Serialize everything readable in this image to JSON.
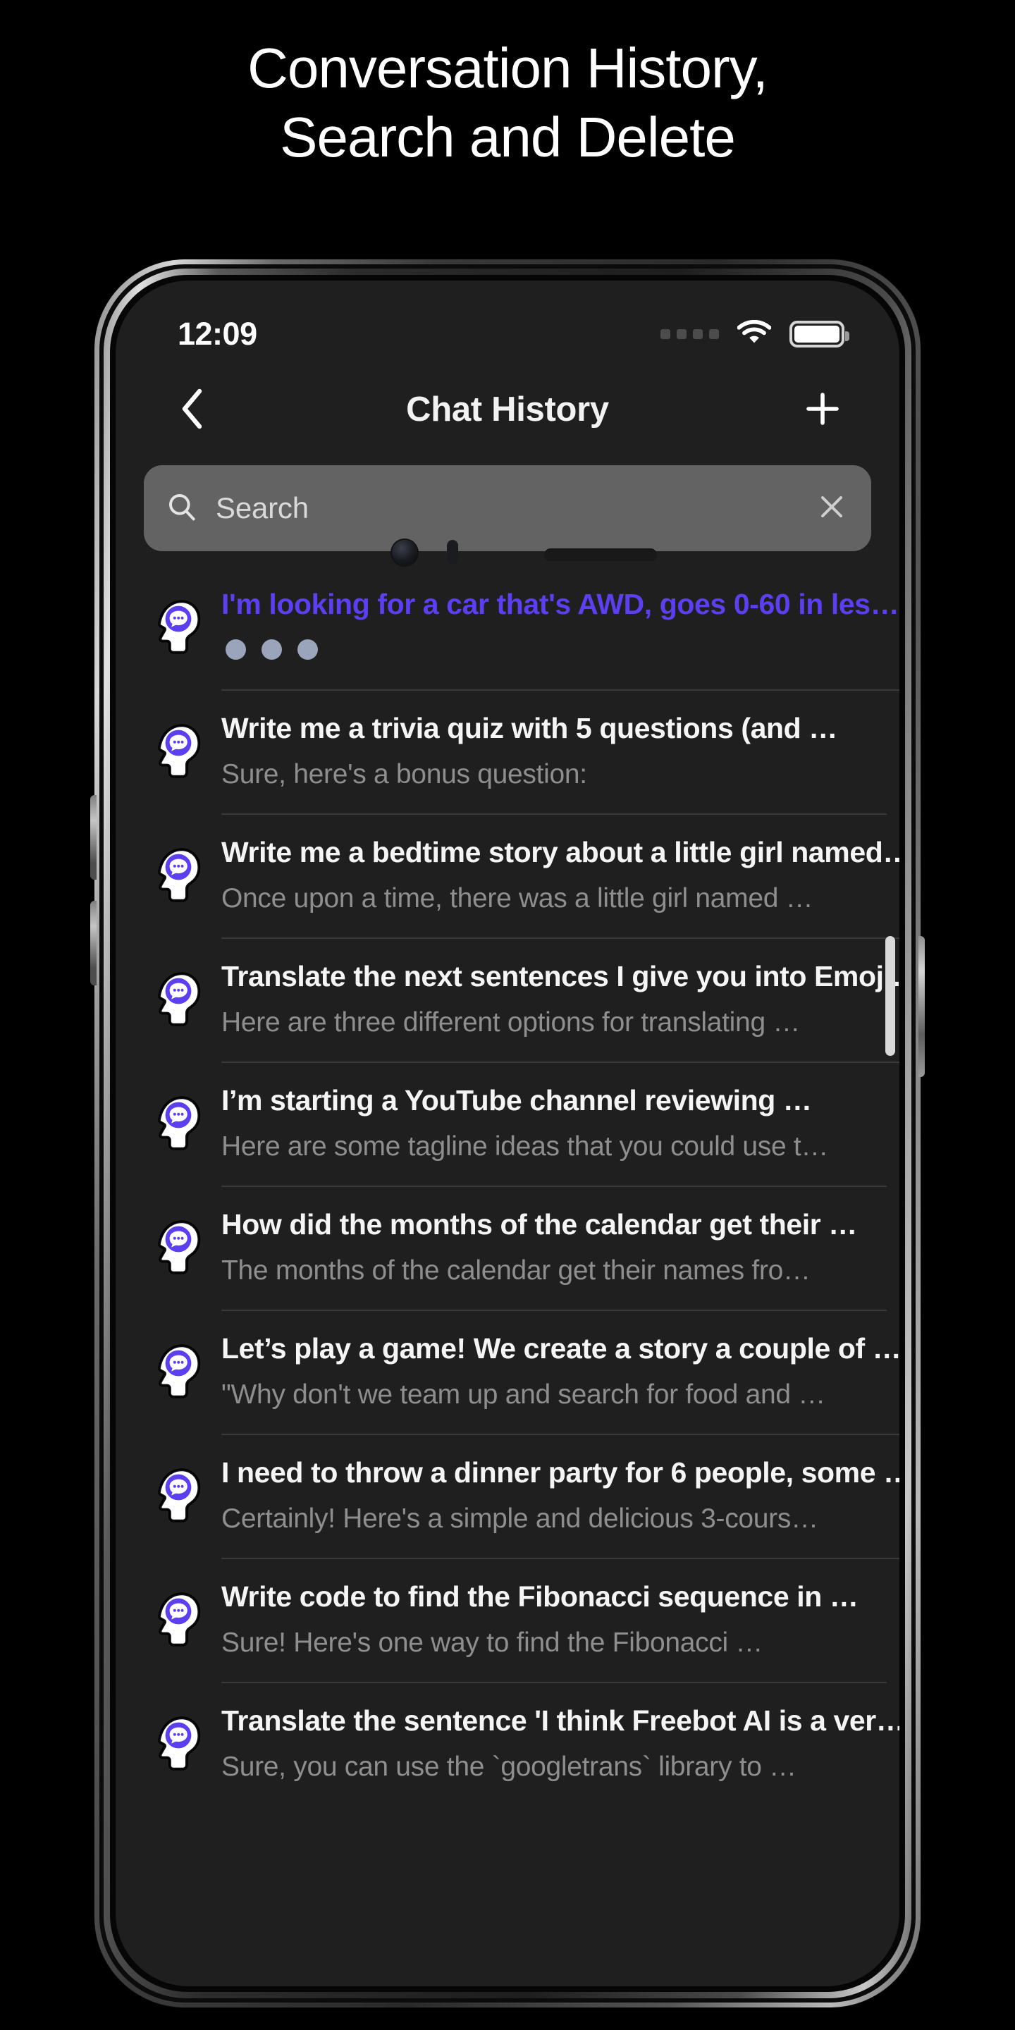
{
  "headline": {
    "line1": "Conversation History,",
    "line2": "Search and Delete"
  },
  "colors": {
    "accent": "#5b3ff0",
    "screen_bg": "#1f1f1f",
    "page_bg": "#000000",
    "title_text": "#f5f5f5",
    "subtitle_text": "#8e8e8e",
    "search_field": "#636363",
    "typing_dot": "#9aa5bb"
  },
  "statusbar": {
    "time": "12:09",
    "signal_icon": "signal-dots-icon",
    "wifi_icon": "wifi-icon",
    "battery_icon": "battery-full-icon"
  },
  "navbar": {
    "back_icon": "chevron-left-icon",
    "title": "Chat History",
    "add_icon": "plus-icon"
  },
  "search": {
    "icon": "search-icon",
    "placeholder": "Search",
    "value": "",
    "clear_icon": "close-icon"
  },
  "list": {
    "avatar_icon": "brain-chat-avatar-icon",
    "items": [
      {
        "title": "I'm looking for a car that's AWD, goes 0-60 in les…",
        "subtitle": "",
        "state": "generating",
        "typing_dots": 3
      },
      {
        "title": "Write me a trivia quiz with 5 questions (and …",
        "subtitle": "Sure, here's a bonus question:",
        "state": "idle"
      },
      {
        "title": "Write me a bedtime story about a little girl named…",
        "subtitle": "Once upon a time, there was a little girl named …",
        "state": "idle"
      },
      {
        "title": "Translate the next sentences I give you into Emoji…",
        "subtitle": "Here are three different options for translating …",
        "state": "idle"
      },
      {
        "title": "I’m starting a YouTube channel reviewing …",
        "subtitle": "Here are some tagline ideas that you could use t…",
        "state": "idle"
      },
      {
        "title": "How did the months of the calendar get their …",
        "subtitle": "The months of the calendar get their names fro…",
        "state": "idle"
      },
      {
        "title": "Let’s play a game!  We create a story a couple of …",
        "subtitle": "\"Why don't we team up and search for food and …",
        "state": "idle"
      },
      {
        "title": "I need to throw a dinner party for 6 people, some …",
        "subtitle": "Certainly! Here's a simple and delicious 3-cours…",
        "state": "idle"
      },
      {
        "title": "Write code to find the Fibonacci sequence in …",
        "subtitle": "Sure! Here's one way to find the Fibonacci …",
        "state": "idle"
      },
      {
        "title": "Translate the sentence 'I think Freebot AI is a ver…",
        "subtitle": "Sure, you can use the `googletrans` library to …",
        "state": "idle"
      }
    ]
  }
}
